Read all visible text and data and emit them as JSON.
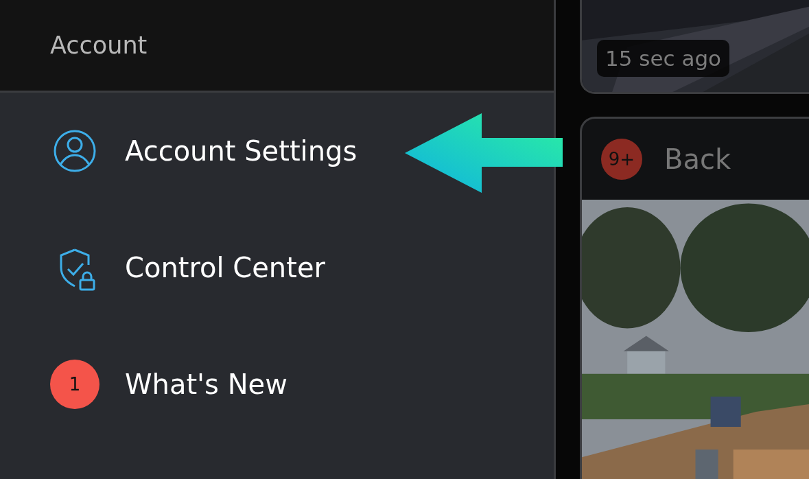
{
  "sidebar": {
    "header": "Account",
    "items": [
      {
        "kind": "user",
        "label": "Account Settings"
      },
      {
        "kind": "shield",
        "label": "Control Center"
      },
      {
        "kind": "count",
        "count": "1",
        "label": "What's New"
      }
    ]
  },
  "cameras": [
    {
      "kind": "timestamp",
      "timestamp": "15 sec ago"
    },
    {
      "kind": "titled",
      "count": "9+",
      "title": "Back"
    }
  ]
}
